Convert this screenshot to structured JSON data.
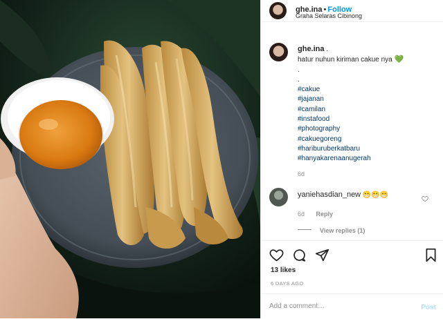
{
  "post_header": {
    "username": "ghe.ina",
    "separator": "•",
    "follow_label": "Follow",
    "location": "Graha Selaras Cibinong"
  },
  "caption": {
    "username": "ghe.ina",
    "suffix": ".",
    "text": "hatur nuhun kiriman cakue nya",
    "emoji": "💚",
    "dots": [
      ".",
      "."
    ],
    "hashtags": [
      "#cakue",
      "#jajanan",
      "#camilan",
      "#instafood",
      "#photography",
      "#cakuegoreng",
      "#hariburuberkatbaru",
      "#hanyakarenaanugerah"
    ],
    "time": "6d"
  },
  "comment": {
    "username": "yaniehasdian_new",
    "text": "😁😁😁",
    "time": "6d",
    "reply_label": "Reply",
    "view_replies_label": "View replies (1)"
  },
  "actions": {
    "like_icon": "heart-icon",
    "comment_icon": "comment-icon",
    "share_icon": "share-icon",
    "save_icon": "bookmark-icon"
  },
  "likes": "13 likes",
  "posted_ago": "6 DAYS AGO",
  "add_comment": {
    "placeholder": "Add a comment…",
    "post_label": "Post"
  }
}
